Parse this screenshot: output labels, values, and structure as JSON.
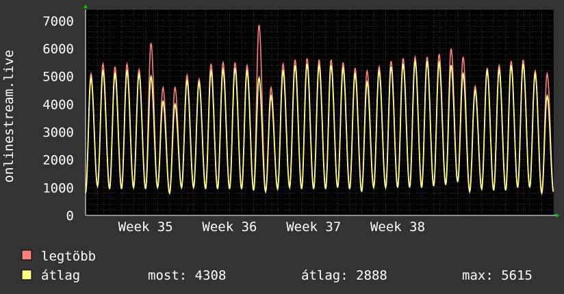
{
  "chart_data": {
    "type": "line",
    "ylabel": "onlinestream.live",
    "ylim": [
      0,
      7400
    ],
    "yticks": [
      0,
      1000,
      2000,
      3000,
      4000,
      5000,
      6000,
      7000
    ],
    "xlabels": [
      "Week 35",
      "Week 36",
      "Week 37",
      "Week 38"
    ],
    "x": "hourly samples, 5 weeks",
    "series": [
      {
        "name": "legtöbb",
        "color": "#ff7f7f"
      },
      {
        "name": "átlag",
        "color": "#ffff7f"
      }
    ],
    "daily_peak_max": [
      5100,
      5450,
      5350,
      5450,
      5250,
      6200,
      4600,
      4600,
      5050,
      4900,
      5450,
      5500,
      5500,
      5400,
      6850,
      4600,
      5450,
      5600,
      5650,
      5600,
      5600,
      5500,
      5300,
      5200,
      5350,
      5550,
      5650,
      5700,
      5700,
      5800,
      6000,
      5700,
      4650,
      5300,
      5400,
      5550,
      5600,
      5200,
      5100
    ],
    "daily_peak_avg": [
      4950,
      5200,
      5100,
      5200,
      5100,
      5000,
      4100,
      4000,
      4850,
      4800,
      5200,
      5250,
      5300,
      5200,
      4950,
      4300,
      5200,
      5400,
      5450,
      5400,
      5400,
      5300,
      5100,
      4800,
      5200,
      5350,
      5450,
      5550,
      5550,
      5500,
      5400,
      5100,
      4500,
      5200,
      5250,
      5400,
      5450,
      5100,
      4300
    ],
    "daily_min": [
      800,
      1050,
      950,
      950,
      1000,
      950,
      1000,
      800,
      1000,
      1000,
      950,
      950,
      950,
      950,
      900,
      850,
      950,
      1000,
      950,
      950,
      950,
      1000,
      950,
      850,
      1000,
      1000,
      1000,
      1000,
      1000,
      1050,
      1100,
      1200,
      850,
      950,
      900,
      900,
      1000,
      1000,
      800
    ]
  },
  "legend": {
    "max_label": "legtöbb",
    "avg_label": "átlag",
    "now_text": "most: 4308",
    "avg_text": "átlag: 2888",
    "max_text": "max: 5615"
  },
  "colors": {
    "background": "#333333",
    "plot_bg": "#000000",
    "grid_minor": "#3a3a3a",
    "grid_major": "#5a2020",
    "max_line": "#ff7f7f",
    "avg_line": "#ffff7f",
    "arrow": "#00c000"
  }
}
